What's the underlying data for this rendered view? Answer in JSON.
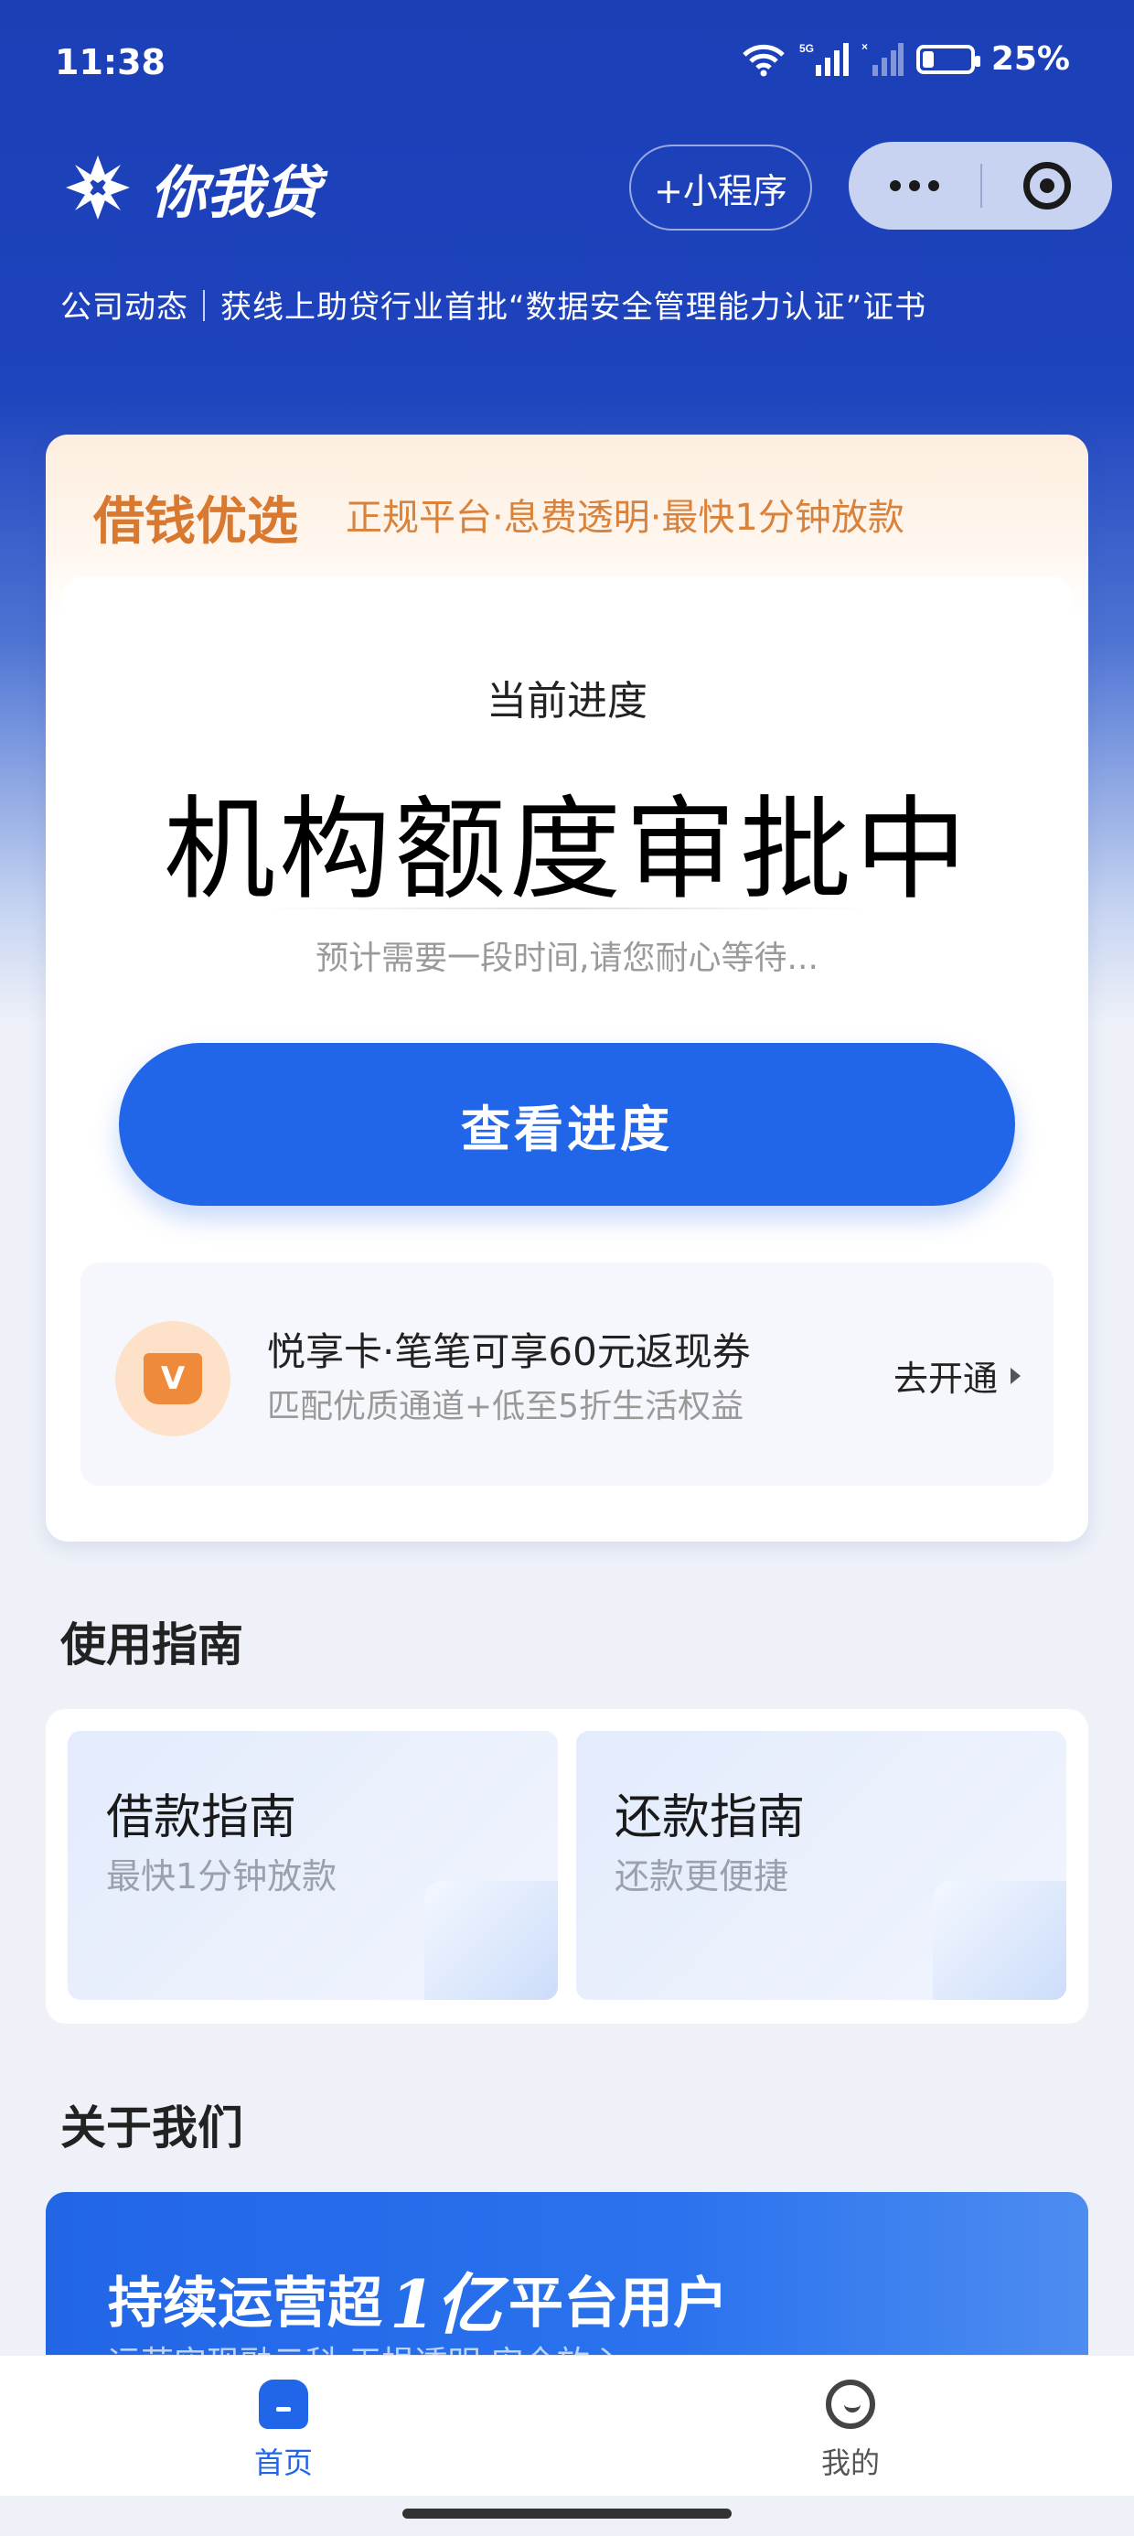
{
  "status_bar": {
    "time": "11:38",
    "network": "5G",
    "battery": "25%"
  },
  "header": {
    "logo_text": "你我贷",
    "mini_program_button": "+小程序",
    "news_text": "公司动态｜获线上助贷行业首批“数据安全管理能力认证”证书"
  },
  "loan_card": {
    "brand_title": "借钱优选",
    "brand_subtitle": "正规平台·息费透明·最快1分钟放款",
    "progress_label": "当前进度",
    "status": "机构额度审批中",
    "wait_text": "预计需要一段时间,请您耐心等待...",
    "view_button": "查看进度",
    "vip": {
      "icon_text": "V",
      "title": "悦享卡·笔笔可享60元返现券",
      "subtitle": "匹配优质通道+低至5折生活权益",
      "action": "去开通"
    }
  },
  "guide": {
    "section_title": "使用指南",
    "cards": [
      {
        "title": "借款指南",
        "subtitle": "最快1分钟放款"
      },
      {
        "title": "还款指南",
        "subtitle": "还款更便捷"
      }
    ]
  },
  "about": {
    "section_title": "关于我们",
    "banner_prefix": "持续运营超",
    "banner_highlight": "1亿",
    "banner_suffix": "平台用户",
    "banner_sub": "运营实现融云科·无损透明·安全放心"
  },
  "tab_bar": {
    "tabs": [
      {
        "label": "首页",
        "active": true,
        "color": "#2165e8"
      },
      {
        "label": "我的",
        "active": false,
        "color": "#555555"
      }
    ]
  },
  "colors": {
    "brand_blue": "#1d43bd",
    "button_blue": "#2165e8",
    "accent_orange": "#d9792f"
  }
}
